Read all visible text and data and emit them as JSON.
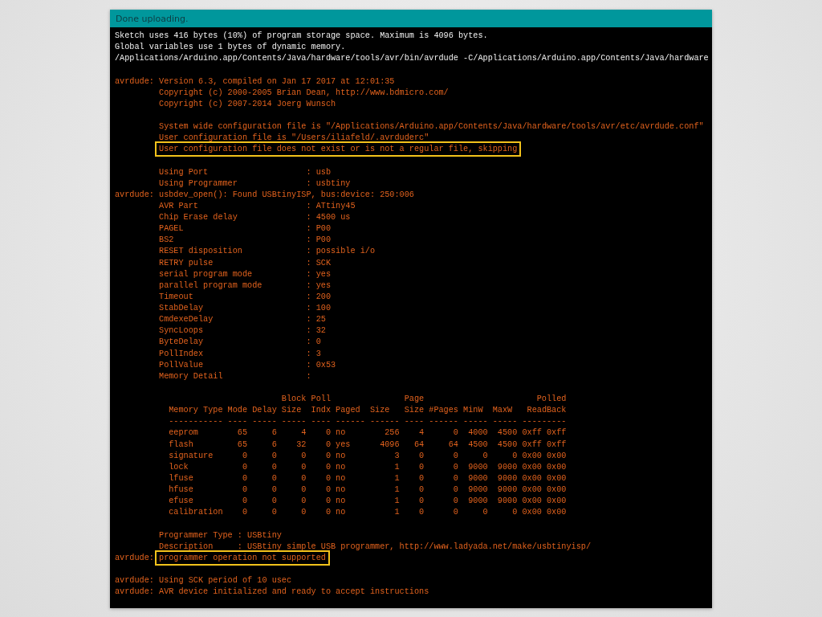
{
  "status_bar": {
    "text": "Done uploading."
  },
  "console": {
    "lines": [
      {
        "kind": "output",
        "text": "Sketch uses 416 bytes (10%) of program storage space. Maximum is 4096 bytes."
      },
      {
        "kind": "output",
        "text": "Global variables use 1 bytes of dynamic memory."
      },
      {
        "kind": "output",
        "text": "/Applications/Arduino.app/Contents/Java/hardware/tools/avr/bin/avrdude -C/Applications/Arduino.app/Contents/Java/hardware"
      },
      {
        "kind": "blank"
      },
      {
        "kind": "log",
        "text": "avrdude: Version 6.3, compiled on Jan 17 2017 at 12:01:35"
      },
      {
        "kind": "log",
        "text": "         Copyright (c) 2000-2005 Brian Dean, http://www.bdmicro.com/"
      },
      {
        "kind": "log",
        "text": "         Copyright (c) 2007-2014 Joerg Wunsch"
      },
      {
        "kind": "blank"
      },
      {
        "kind": "log",
        "text": "         System wide configuration file is \"/Applications/Arduino.app/Contents/Java/hardware/tools/avr/etc/avrdude.conf\""
      },
      {
        "kind": "log",
        "text": "         User configuration file is \"/Users/iliafeld/.avrduderc\""
      },
      {
        "kind": "log",
        "text": "         User configuration file does not exist or is not a regular file, skipping",
        "highlighted": true
      },
      {
        "kind": "blank"
      },
      {
        "kind": "log",
        "text": "         Using Port                    : usb"
      },
      {
        "kind": "log",
        "text": "         Using Programmer              : usbtiny"
      },
      {
        "kind": "log",
        "text": "avrdude: usbdev_open(): Found USBtinyISP, bus:device: 250:006"
      },
      {
        "kind": "log",
        "text": "         AVR Part                      : ATtiny45"
      },
      {
        "kind": "log",
        "text": "         Chip Erase delay              : 4500 us"
      },
      {
        "kind": "log",
        "text": "         PAGEL                         : P00"
      },
      {
        "kind": "log",
        "text": "         BS2                           : P00"
      },
      {
        "kind": "log",
        "text": "         RESET disposition             : possible i/o"
      },
      {
        "kind": "log",
        "text": "         RETRY pulse                   : SCK"
      },
      {
        "kind": "log",
        "text": "         serial program mode           : yes"
      },
      {
        "kind": "log",
        "text": "         parallel program mode         : yes"
      },
      {
        "kind": "log",
        "text": "         Timeout                       : 200"
      },
      {
        "kind": "log",
        "text": "         StabDelay                     : 100"
      },
      {
        "kind": "log",
        "text": "         CmdexeDelay                   : 25"
      },
      {
        "kind": "log",
        "text": "         SyncLoops                     : 32"
      },
      {
        "kind": "log",
        "text": "         ByteDelay                     : 0"
      },
      {
        "kind": "log",
        "text": "         PollIndex                     : 3"
      },
      {
        "kind": "log",
        "text": "         PollValue                     : 0x53"
      },
      {
        "kind": "log",
        "text": "         Memory Detail                 :"
      },
      {
        "kind": "blank"
      },
      {
        "kind": "log",
        "text": "                                  Block Poll               Page                       Polled"
      },
      {
        "kind": "log",
        "text": "           Memory Type Mode Delay Size  Indx Paged  Size   Size #Pages MinW  MaxW   ReadBack"
      },
      {
        "kind": "log",
        "text": "           ----------- ---- ----- ----- ---- ------ ------ ---- ------ ----- ----- ---------"
      },
      {
        "kind": "log",
        "text": "           eeprom        65     6     4    0 no        256    4      0  4000  4500 0xff 0xff"
      },
      {
        "kind": "log",
        "text": "           flash         65     6    32    0 yes      4096   64     64  4500  4500 0xff 0xff"
      },
      {
        "kind": "log",
        "text": "           signature      0     0     0    0 no          3    0      0     0     0 0x00 0x00"
      },
      {
        "kind": "log",
        "text": "           lock           0     0     0    0 no          1    0      0  9000  9000 0x00 0x00"
      },
      {
        "kind": "log",
        "text": "           lfuse          0     0     0    0 no          1    0      0  9000  9000 0x00 0x00"
      },
      {
        "kind": "log",
        "text": "           hfuse          0     0     0    0 no          1    0      0  9000  9000 0x00 0x00"
      },
      {
        "kind": "log",
        "text": "           efuse          0     0     0    0 no          1    0      0  9000  9000 0x00 0x00"
      },
      {
        "kind": "log",
        "text": "           calibration    0     0     0    0 no          1    0      0     0     0 0x00 0x00"
      },
      {
        "kind": "blank"
      },
      {
        "kind": "log",
        "text": "         Programmer Type : USBtiny"
      },
      {
        "kind": "log",
        "text": "         Description     : USBtiny simple USB programmer, http://www.ladyada.net/make/usbtinyisp/"
      },
      {
        "kind": "log",
        "prefix": "avrdude: ",
        "text": "programmer operation not supported",
        "highlighted": true
      },
      {
        "kind": "blank"
      },
      {
        "kind": "log",
        "text": "avrdude: Using SCK period of 10 usec"
      },
      {
        "kind": "log",
        "text": "avrdude: AVR device initialized and ready to accept instructions"
      }
    ]
  }
}
